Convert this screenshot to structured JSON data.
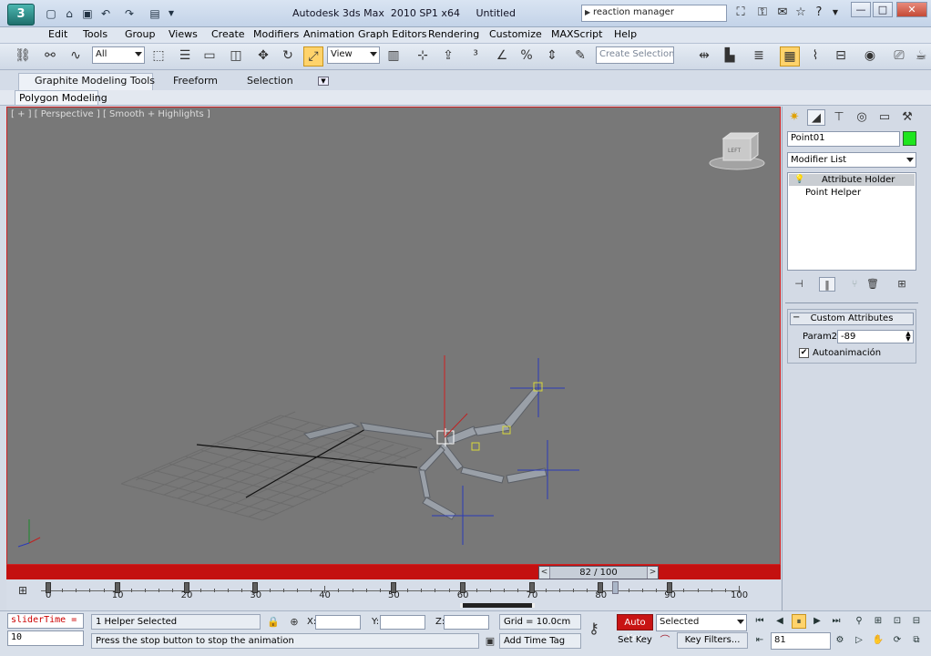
{
  "window": {
    "app_title": "Autodesk 3ds Max  2010 SP1 x64",
    "doc_title": "Untitled",
    "logo": "3",
    "search_value": "reaction manager",
    "controls": {
      "minimize": "—",
      "maximize": "□",
      "close": "✕"
    }
  },
  "quick_access": [
    "new-icon",
    "open-icon",
    "save-icon",
    "undo-icon",
    "redo-icon",
    "project-icon"
  ],
  "info_icons": [
    "binoculars-icon",
    "key-icon",
    "communication-icon",
    "favorites-icon",
    "help-icon"
  ],
  "menu": [
    "Edit",
    "Tools",
    "Group",
    "Views",
    "Create",
    "Modifiers",
    "Animation",
    "Graph Editors",
    "Rendering",
    "Customize",
    "MAXScript",
    "Help"
  ],
  "toolbar": {
    "selection_filter": "All",
    "ref_coord": "View",
    "named_selection_placeholder": "Create Selection Se"
  },
  "ribbon": {
    "tabs": [
      "Graphite Modeling Tools",
      "Freeform",
      "Selection"
    ],
    "active_tab": "Graphite Modeling Tools",
    "subtab": "Polygon Modeling"
  },
  "viewport": {
    "label": "[ + ] [ Perspective ] [ Smooth + Highlights ]",
    "viewcube_face": "LEFT",
    "border_color": "#cc2222"
  },
  "timeline": {
    "slider_text": "82 / 100",
    "current_frame": 82,
    "total_frames": 100,
    "ruler_labels": [
      "0",
      "10",
      "20",
      "30",
      "40",
      "50",
      "60",
      "70",
      "80",
      "90",
      "100"
    ],
    "key_frames": [
      0,
      10,
      20,
      30,
      50,
      60,
      70,
      80,
      90
    ],
    "range_start": 60,
    "range_end": 70
  },
  "status": {
    "maxscript_listener": "sliderTime =",
    "maxscript_result": "10",
    "selection_info": "1 Helper Selected",
    "prompt": "Press the stop button to stop the animation",
    "x_label": "X:",
    "y_label": "Y:",
    "z_label": "Z:",
    "grid": "Grid = 10.0cm",
    "add_time_tag": "Add Time Tag",
    "auto_key": "Auto Key",
    "set_key": "Set Key",
    "key_mode": "Selected",
    "key_filters": "Key Filters...",
    "frame": "81"
  },
  "command_panel": {
    "object_name": "Point01",
    "object_color": "#1ee61e",
    "modifier_list": "Modifier List",
    "stack": [
      "Attribute Holder",
      "Point Helper"
    ],
    "rollout_title": "Custom Attributes",
    "param_label": "Param2:",
    "param_value": "-89",
    "checkbox_label": "Autoanimación",
    "checkbox_checked": true
  }
}
